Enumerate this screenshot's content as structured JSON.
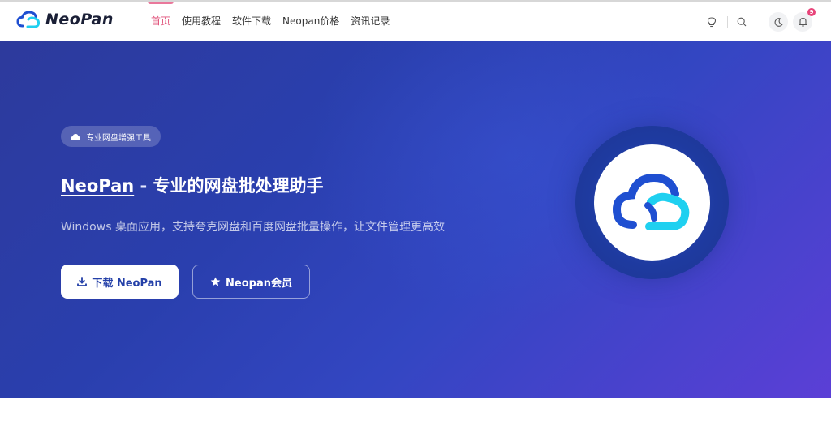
{
  "header": {
    "brand": "NeoPan",
    "nav": [
      {
        "label": "首页",
        "active": true
      },
      {
        "label": "使用教程",
        "active": false
      },
      {
        "label": "软件下载",
        "active": false
      },
      {
        "label": "Neopan价格",
        "active": false
      },
      {
        "label": "资讯记录",
        "active": false
      }
    ],
    "icons": [
      "lightbulb-icon",
      "search-icon",
      "moon-icon",
      "bell-icon"
    ],
    "notification_count": "9"
  },
  "hero": {
    "tag": "专业网盘增强工具",
    "title_brand": "NeoPan",
    "title_sep": " - ",
    "title_rest": "专业的网盘批处理助手",
    "subtitle": "Windows 桌面应用，支持夸克网盘和百度网盘批量操作，让文件管理更高效",
    "download_button": "下载 NeoPan",
    "member_button": "Neopan会员"
  },
  "colors": {
    "accent_pink": "#e0527a",
    "hero_start": "#2d3a9c",
    "hero_end": "#5b3fd6",
    "logo_blue": "#1f4fd1",
    "logo_cyan": "#1fd0f0"
  }
}
